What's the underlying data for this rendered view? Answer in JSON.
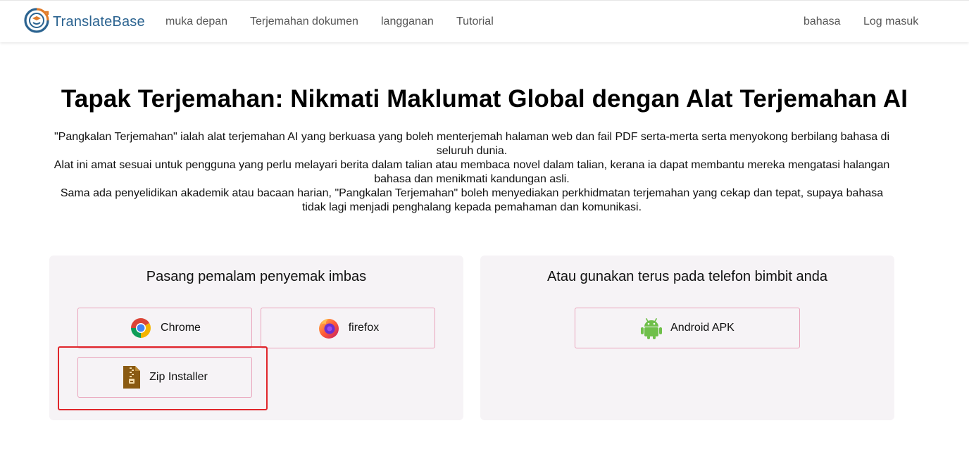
{
  "header": {
    "brand": "TranslateBase",
    "nav": [
      "muka depan",
      "Terjemahan dokumen",
      "langganan",
      "Tutorial"
    ],
    "right": [
      "bahasa",
      "Log masuk"
    ]
  },
  "hero": {
    "title": "Tapak Terjemahan: Nikmati Maklumat Global dengan Alat Terjemahan AI",
    "lines": [
      "\"Pangkalan Terjemahan\" ialah alat terjemahan AI yang berkuasa yang boleh menterjemah halaman web dan fail PDF serta-merta serta menyokong berbilang bahasa di seluruh dunia.",
      "Alat ini amat sesuai untuk pengguna yang perlu melayari berita dalam talian atau membaca novel dalam talian, kerana ia dapat membantu mereka mengatasi halangan bahasa dan menikmati kandungan asli.",
      "Sama ada penyelidikan akademik atau bacaan harian, \"Pangkalan Terjemahan\" boleh menyediakan perkhidmatan terjemahan yang cekap dan tepat, supaya bahasa tidak lagi menjadi penghalang kepada pemahaman dan komunikasi."
    ]
  },
  "extension_card": {
    "title": "Pasang pemalam penyemak imbas",
    "buttons": [
      {
        "label": "Chrome",
        "icon": "chrome-icon"
      },
      {
        "label": "firefox",
        "icon": "firefox-icon"
      },
      {
        "label": "Zip Installer",
        "icon": "zip-file-icon"
      }
    ]
  },
  "mobile_card": {
    "title": "Atau gunakan terus pada telefon bimbit anda",
    "buttons": [
      {
        "label": "Android APK",
        "icon": "android-icon"
      }
    ]
  },
  "colors": {
    "brand": "#2b6390",
    "card_bg": "#f6f3f6",
    "button_border": "#e9a3bb",
    "highlight": "#e0262b"
  }
}
